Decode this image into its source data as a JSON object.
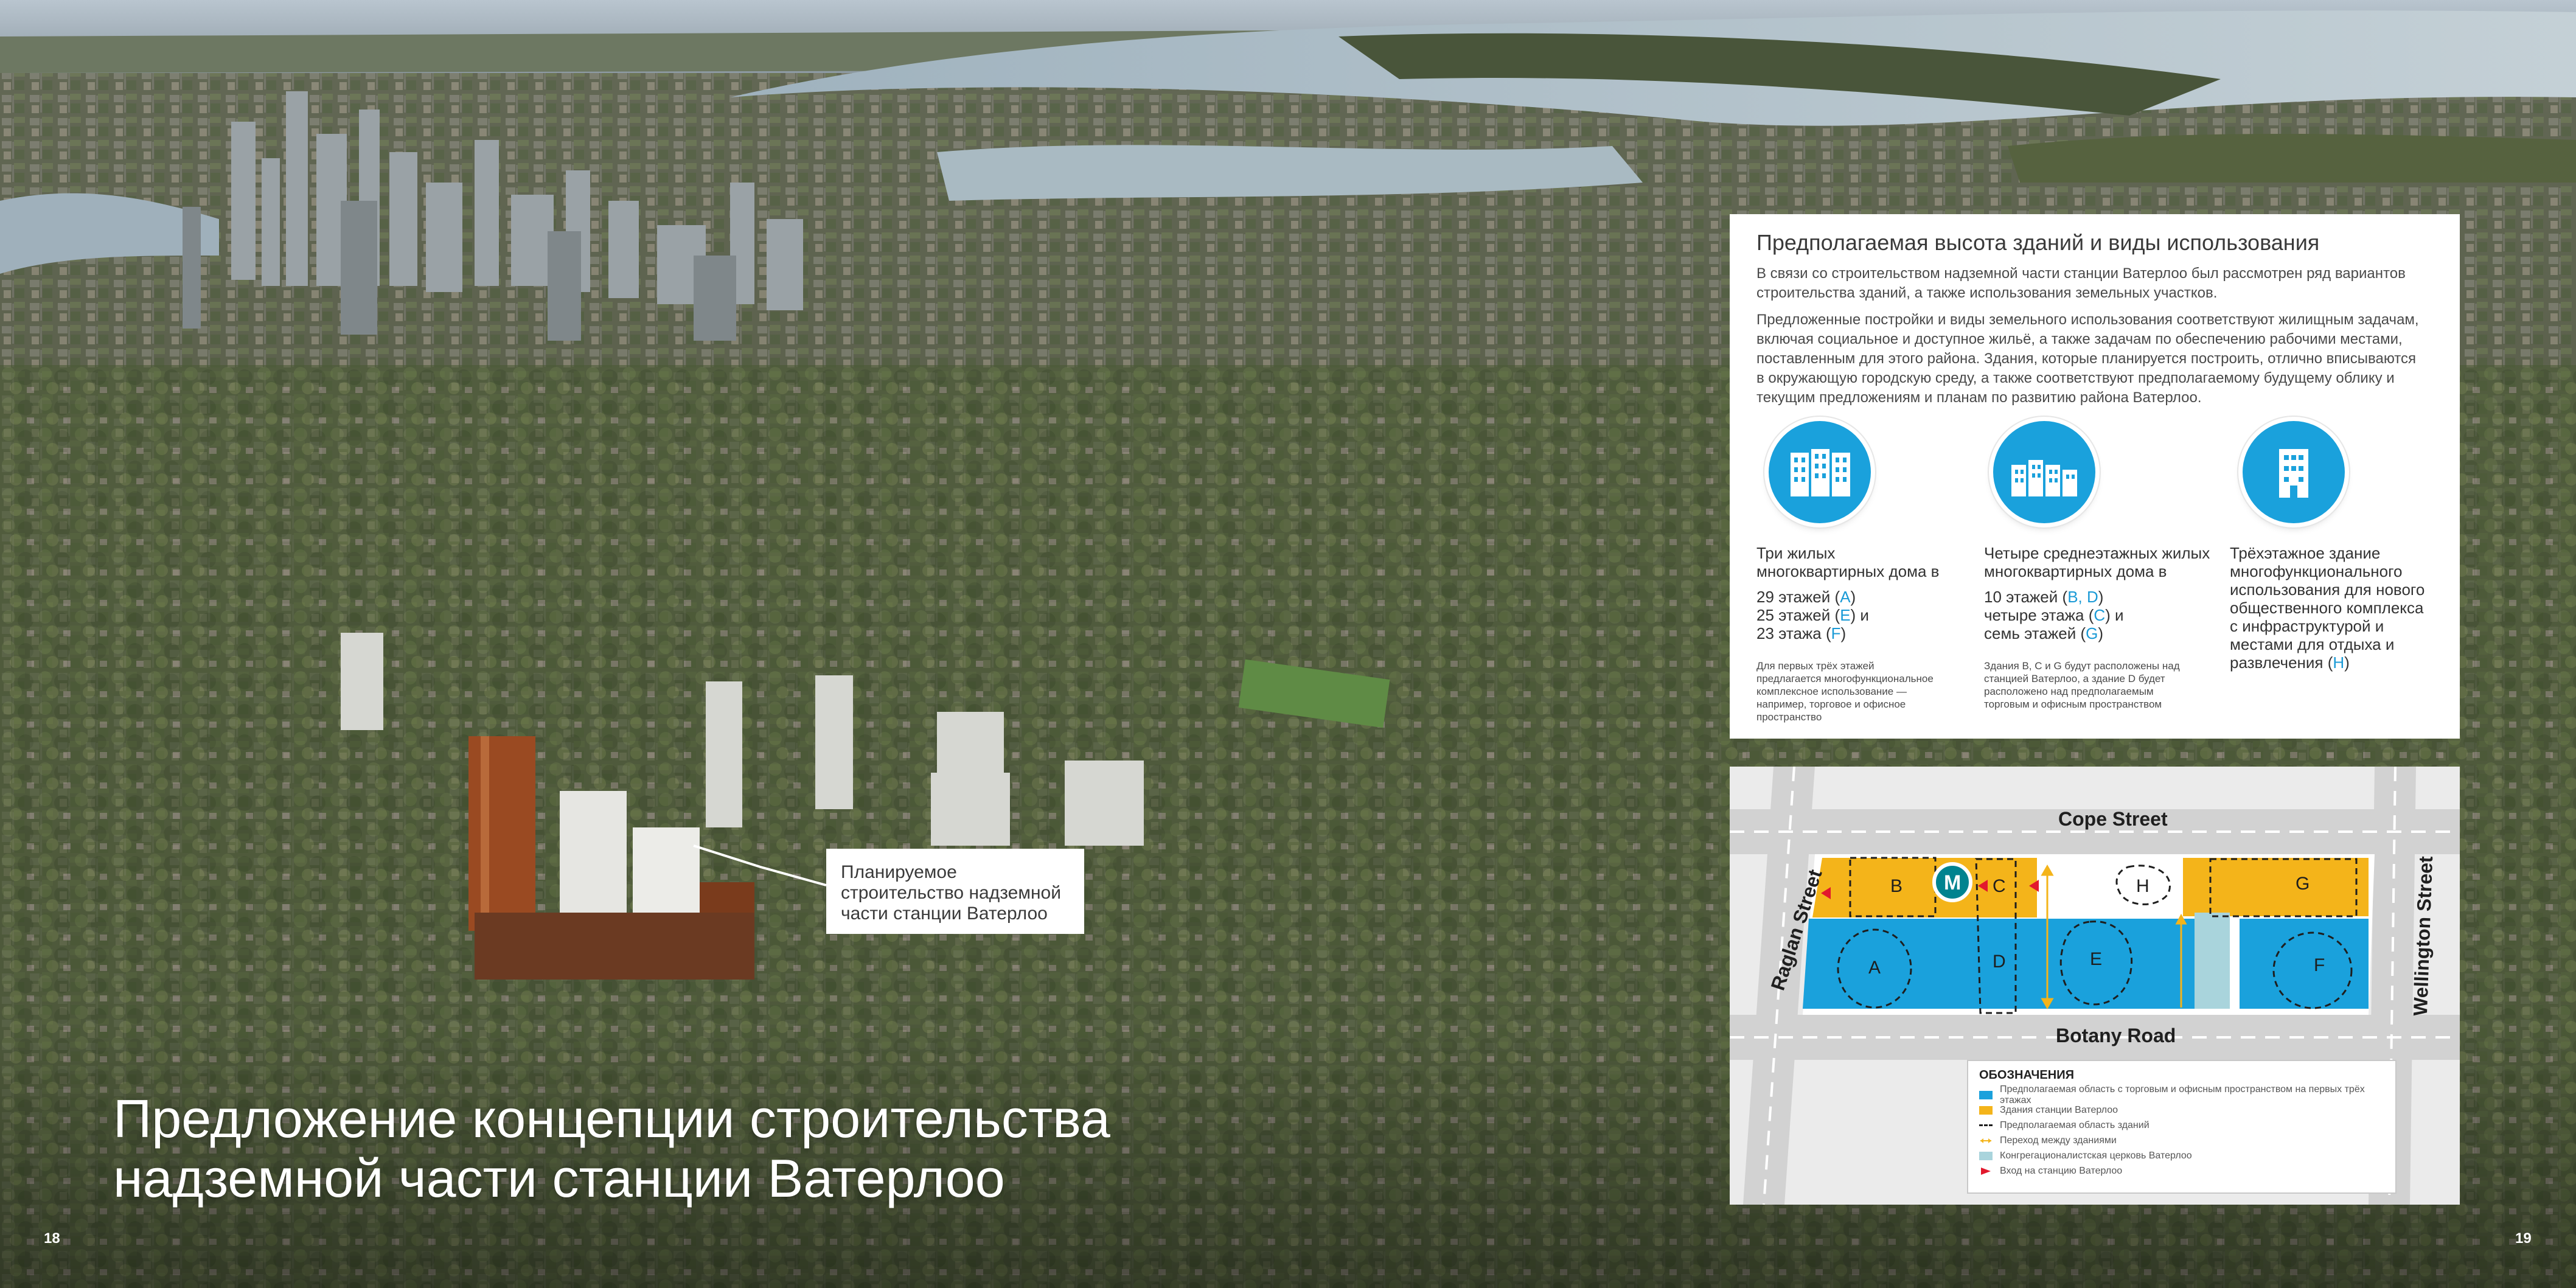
{
  "page": {
    "left_number": "18",
    "right_number": "19",
    "hero_title_line1": "Предложение концепции строительства",
    "hero_title_line2": "надземной части станции Ватерлоо"
  },
  "callout": {
    "line1": "Планируемое",
    "line2": "строительство надземной",
    "line3": "части станции Ватерлоо"
  },
  "panel": {
    "title": "Предполагаемая высота зданий и виды использования",
    "p1_line1": "В связи со строительством надземной части станции Ватерлоо был рассмотрен ряд вариантов",
    "p1_line2": "строительства зданий, а также использования земельных участков.",
    "p2_line1": "Предложенные постройки и виды земельного использования соответствуют жилищным задачам,",
    "p2_line2": "включая социальное и доступное жильё, а также задачам по обеспечению рабочими местами,",
    "p2_line3": "поставленным для этого района. Здания, которые планируется построить, отлично вписываются",
    "p2_line4": "в окружающую городскую среду, а также соответствуют предполагаемому будущему облику и",
    "p2_line5": "текущим предложениям и планам по развитию района Ватерлоо.",
    "columns": [
      {
        "icon": "three-towers-icon",
        "h1": "Три жилых",
        "h2": "многоквартирных дома в",
        "v1": "29 этажей (",
        "v1c": "A",
        "v1e": ")",
        "v2": "25 этажей (",
        "v2c": "E",
        "v2e": ") и",
        "v3": "23 этажа (",
        "v3c": "F",
        "v3e": ")",
        "s1": "Для первых трёх этажей",
        "s2": "предлагается многофункциональное",
        "s3": "комплексное использование —",
        "s4": "например, торговое и офисное",
        "s5": "пространство"
      },
      {
        "icon": "four-buildings-icon",
        "h1": "Четыре среднеэтажных жилых",
        "h2": "многоквартирных дома в",
        "v1": "10 этажей (",
        "v1c": "B, D",
        "v1e": ")",
        "v2": "четыре этажа (",
        "v2c": "C",
        "v2e": ") и",
        "v3": "семь этажей (",
        "v3c": "G",
        "v3e": ")",
        "s1": "Здания B, C и G будут расположены над",
        "s2": "станцией Ватерлоо, а здание D будет",
        "s3": "расположено над предполагаемым",
        "s4": "торговым и офисным пространством"
      },
      {
        "icon": "single-building-icon",
        "h1": "Трёхэтажное здание",
        "h2": "многофункционального",
        "h3": "использования для нового",
        "h4": "общественного комплекса",
        "h5": "с инфраструктурой и",
        "h6": "местами для отдыха и",
        "h7a": "развлечения (",
        "h7c": "H",
        "h7e": ")"
      }
    ]
  },
  "map": {
    "streets": {
      "cope": "Cope Street",
      "botany": "Botany Road",
      "raglan": "Raglan Street",
      "wellington": "Wellington Street"
    },
    "labels": {
      "a": "A",
      "b": "B",
      "c": "C",
      "d": "D",
      "e": "E",
      "f": "F",
      "g": "G",
      "h": "H",
      "metro": "M"
    },
    "legend": {
      "title": "ОБОЗНАЧЕНИЯ",
      "items": [
        "Предполагаемая область с торговым и офисным пространством на первых трёх этажах",
        "Здания станции Ватерлоо",
        "Предполагаемая область зданий",
        "Переход между зданиями",
        "Конгрегационалистская церковь Ватерлоо",
        "Вход на станцию Ватерлоо"
      ]
    },
    "colors": {
      "blue": "#1aa1dc",
      "yellow": "#f4b41a",
      "church": "#a9d4dc",
      "entrance": "#e2182d"
    }
  }
}
